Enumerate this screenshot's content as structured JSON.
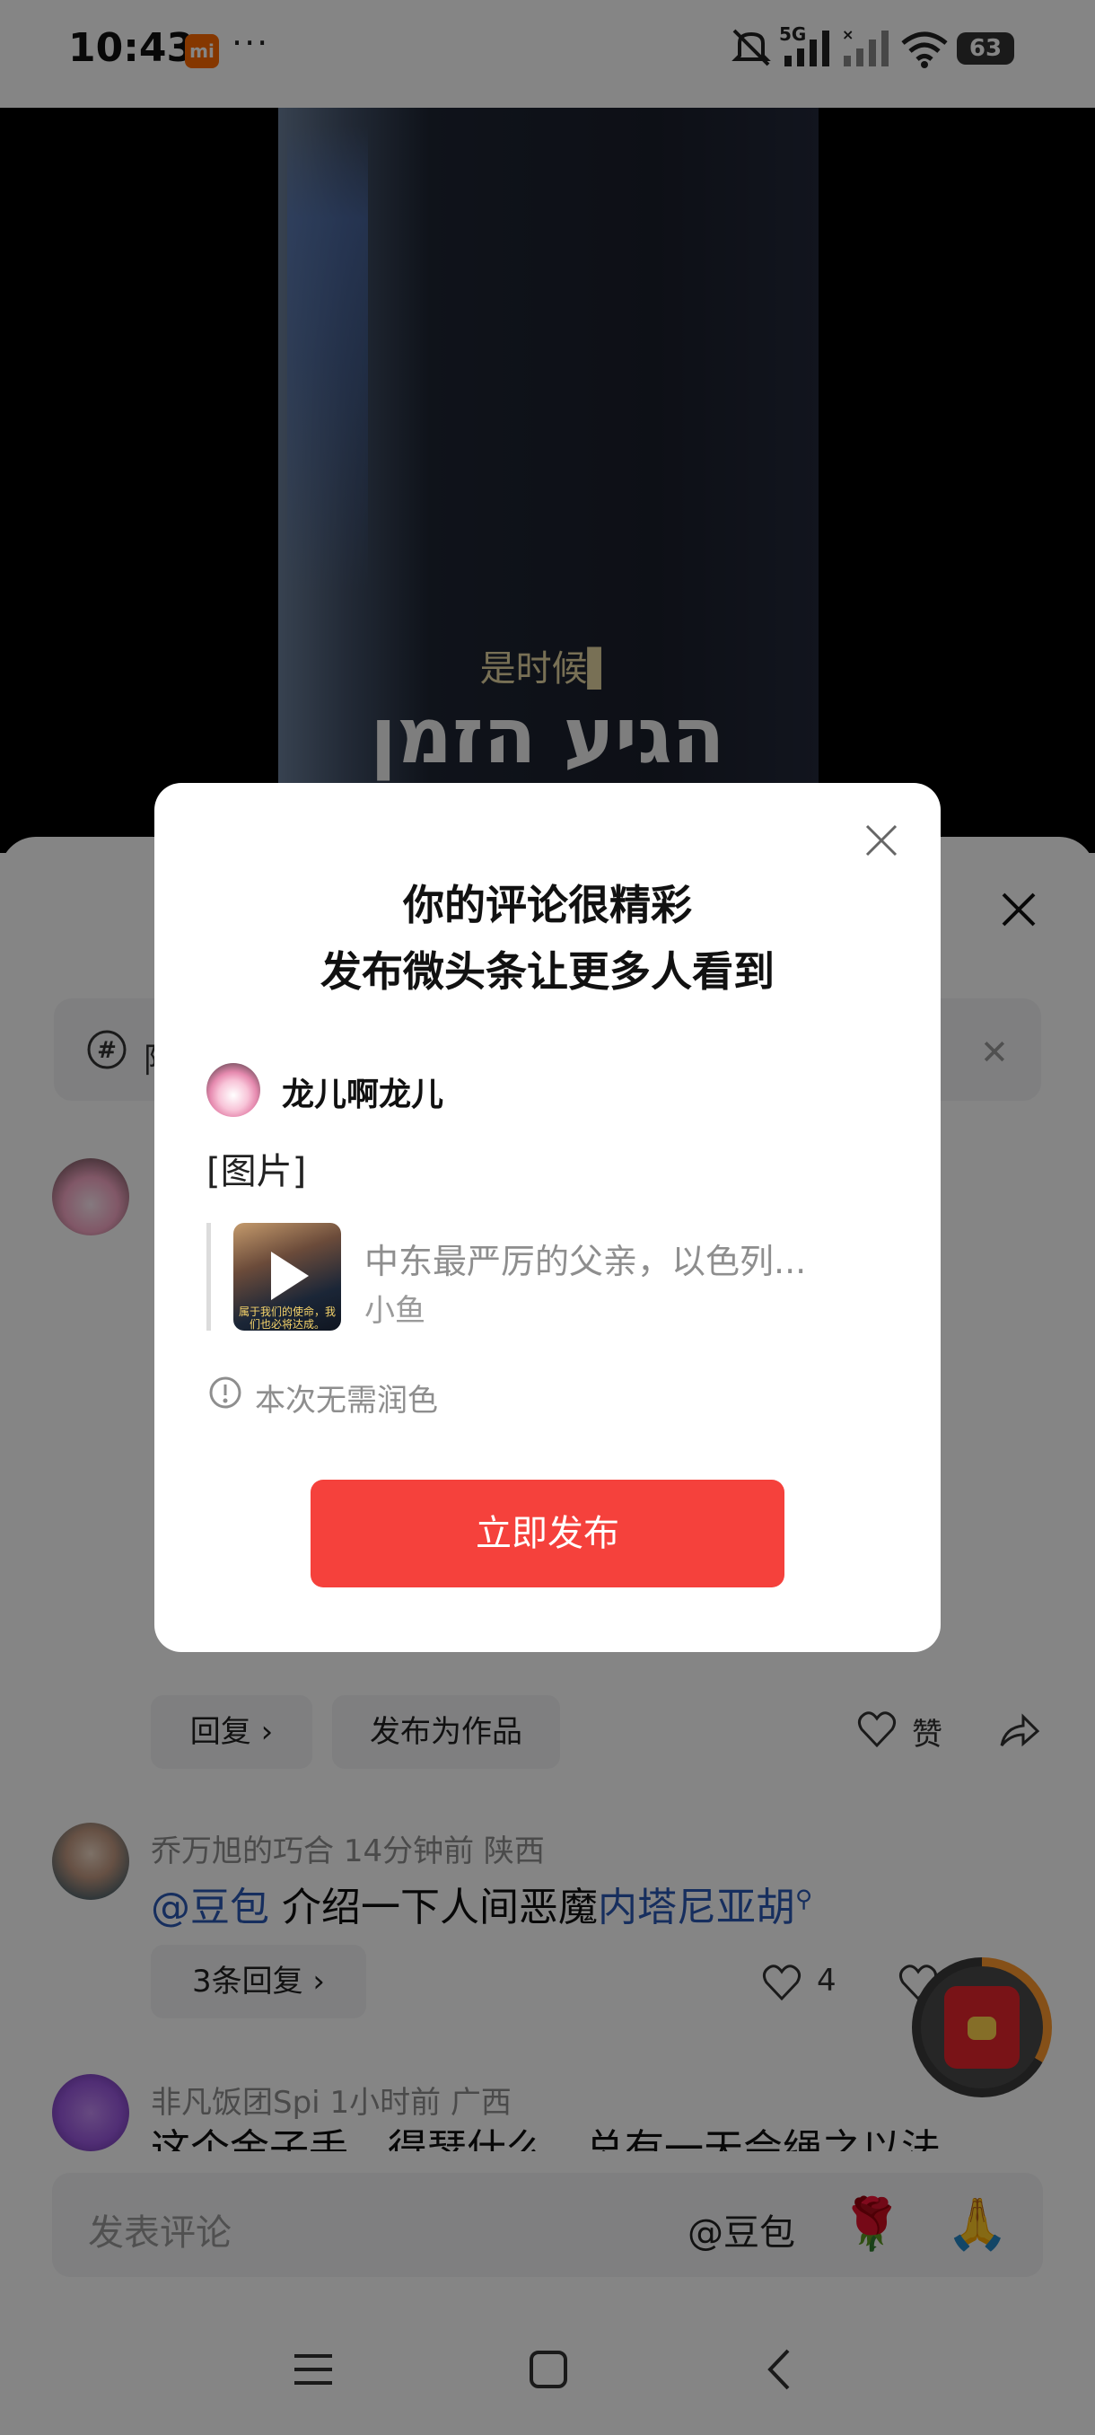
{
  "status_bar": {
    "time": "10:43",
    "mi_badge": "mi",
    "more_dots": "···",
    "network": "5G",
    "battery": "63"
  },
  "video": {
    "subtitle_cn": "是时候▌",
    "subtitle_he": "הגיע הזמן"
  },
  "sheet": {
    "topic_clipped": "阿",
    "comments": [
      {
        "author": "乔万旭的巧合",
        "time": "14分钟前",
        "region": "陕西",
        "mention": "@豆包",
        "text": " 介绍一下人间恶魔",
        "link": "内塔尼亚胡",
        "replies": "3条回复 ›",
        "likes": "4"
      },
      {
        "author": "非凡饭团Spi",
        "time": "1小时前",
        "region": "广西",
        "text_clipped": "这个金子手，得瑟什么，总有一天会绳之以法"
      }
    ],
    "actions": {
      "reply": "回复 ›",
      "publish_as_work": "发布为作品",
      "like": "赞"
    },
    "input": {
      "placeholder": "发表评论",
      "at": "@豆包",
      "emoji_rose": "🌹",
      "emoji_pray": "🙏"
    }
  },
  "dialog": {
    "title_line1": "你的评论很精彩",
    "title_line2": "发布微头条让更多人看到",
    "username": "龙儿啊龙儿",
    "content": "[图片]",
    "quote_title": "中东最严厉的父亲，以色列...",
    "quote_author": "小鱼",
    "thumb_caption": "属于我们的使命，我们也必将达成。",
    "notice": "本次无需润色",
    "publish_button": "立即发布"
  },
  "colors": {
    "accent_red": "#f5413c",
    "mention_blue": "#2b59b5",
    "overlay": "rgba(0,0,0,0.48)"
  }
}
